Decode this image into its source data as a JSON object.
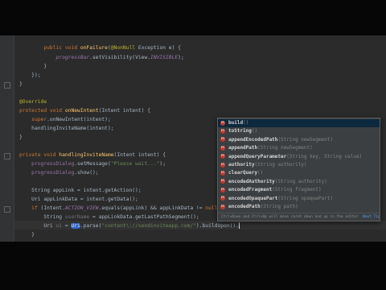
{
  "code": {
    "lines": [
      [
        "        ",
        [
          "kw",
          "public void "
        ],
        [
          "fn",
          "onFailure"
        ],
        "(",
        [
          "ann",
          "@NonNull"
        ],
        " Exception e) {"
      ],
      [
        "            ",
        [
          "field",
          "progressBar"
        ],
        ".setVisibility(View.",
        [
          "field",
          "INVISIBLE"
        ],
        ");"
      ],
      [
        "        }"
      ],
      [
        "    });"
      ],
      [
        "}"
      ],
      [
        ""
      ],
      [
        [
          "ann",
          "@Override"
        ]
      ],
      [
        [
          "kw",
          "protected void "
        ],
        [
          "fn",
          "onNewIntent"
        ],
        "(Intent intent) {"
      ],
      [
        "    ",
        [
          "kw",
          "super"
        ],
        ".onNewIntent(intent);"
      ],
      [
        "    handlingInviteName(intent);"
      ],
      [
        "}"
      ],
      [
        ""
      ],
      [
        [
          "kw",
          "private void "
        ],
        [
          "fn",
          "handlingInviteName"
        ],
        "(Intent intent) {"
      ],
      [
        "    ",
        [
          "field2",
          "progressDialog"
        ],
        ".setMessage(",
        [
          "str",
          "\"Please wait...\""
        ],
        ");"
      ],
      [
        "    ",
        [
          "field2",
          "progressDialog"
        ],
        ".show();"
      ],
      [
        ""
      ],
      [
        "    String appLink = intent.getAction();"
      ],
      [
        "    Uri appLinkData = intent.getData();"
      ],
      [
        "    ",
        [
          "kw",
          "if "
        ],
        "(Intent.",
        [
          "field",
          "ACTION_VIEW"
        ],
        ".equals(appLink) && appLinkData != ",
        [
          "kw",
          "null"
        ],
        ") {"
      ],
      [
        "        String ",
        [
          "unused",
          "userName"
        ],
        " = appLinkData.getLastPathSegment();"
      ],
      [
        "        Uri ",
        [
          "unused",
          "ui"
        ],
        " = ",
        [
          "hl",
          "Uri"
        ],
        ".parse(",
        [
          "str",
          "\"content\\://sendinviteapp.com/\""
        ],
        ").buildUpon().",
        [
          "caret",
          ""
        ]
      ],
      [
        "    }"
      ],
      [
        ""
      ],
      [
        ""
      ]
    ]
  },
  "autocomplete": {
    "items": [
      {
        "icon": "m",
        "name": "build",
        "params": "()"
      },
      {
        "icon": "m",
        "name": "toString",
        "params": "()"
      },
      {
        "icon": "m",
        "name": "appendEncodedPath",
        "params": "(String newSegment)"
      },
      {
        "icon": "m",
        "name": "appendPath",
        "params": "(String newSegment)"
      },
      {
        "icon": "m",
        "name": "appendQueryParameter",
        "params": "(String key, String value)"
      },
      {
        "icon": "m",
        "name": "authority",
        "params": "(String authority)"
      },
      {
        "icon": "m",
        "name": "clearQuery",
        "params": "()"
      },
      {
        "icon": "m",
        "name": "encodedAuthority",
        "params": "(String authority)"
      },
      {
        "icon": "m",
        "name": "encodedFragment",
        "params": "(String fragment)"
      },
      {
        "icon": "m",
        "name": "encodedOpaquePart",
        "params": "(String opaquePart)"
      },
      {
        "icon": "m",
        "name": "encodedPath",
        "params": "(String path)"
      }
    ],
    "hint": "Ctrl+Down and Ctrl+Up will move caret down and up in the editor",
    "hint_link": "Next Tip"
  }
}
